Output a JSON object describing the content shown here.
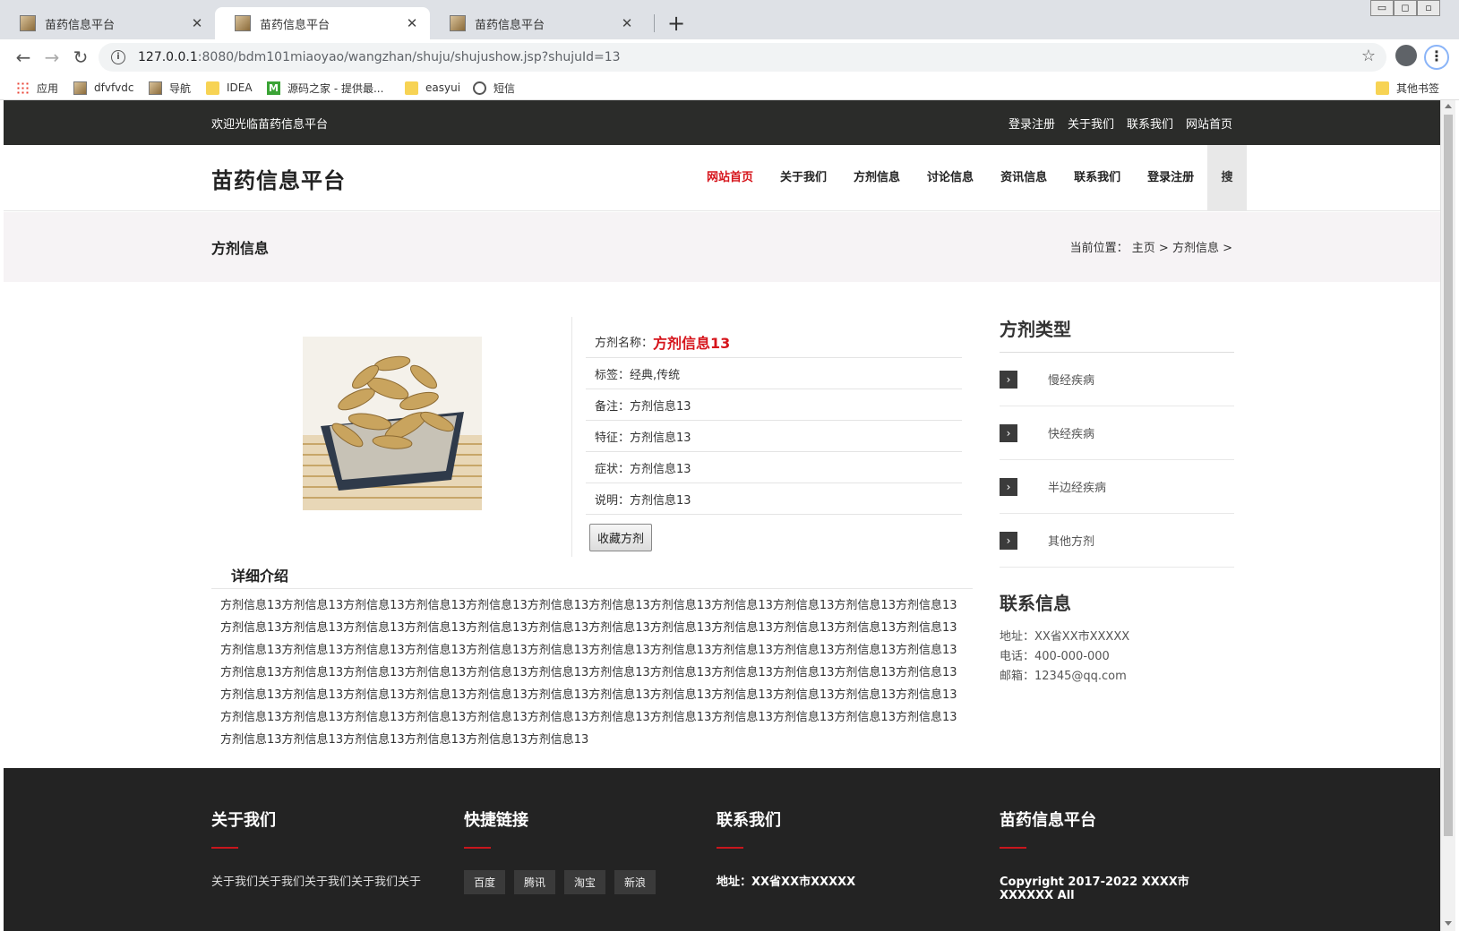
{
  "browser": {
    "tabs": [
      {
        "title": "苗药信息平台",
        "close": "✕"
      },
      {
        "title": "苗药信息平台",
        "close": "✕"
      },
      {
        "title": "苗药信息平台",
        "close": "✕"
      }
    ],
    "new_tab": "+",
    "window_controls": [
      "▭",
      "◻",
      "▫"
    ],
    "url_host": "127.0.0.1",
    "url_path": ":8080/bdm101miaoyao/wangzhan/shuju/shujushow.jsp?shujuId=13",
    "bookmarks": [
      "应用",
      "dfvfvdc",
      "导航",
      "IDEA",
      "源码之家 - 提供最...",
      "easyui",
      "短信"
    ],
    "other_bookmarks": "其他书签"
  },
  "site": {
    "welcome": "欢迎光临苗药信息平台",
    "top_links": [
      "登录注册",
      "关于我们",
      "联系我们",
      "网站首页"
    ],
    "title": "苗药信息平台",
    "nav": [
      "网站首页",
      "关于我们",
      "方剂信息",
      "讨论信息",
      "资讯信息",
      "联系我们",
      "登录注册"
    ],
    "search_label": "搜"
  },
  "banner": {
    "title": "方剂信息",
    "crumb_label": "当前位置：",
    "crumb_home": "主页",
    "crumb_sep": ">",
    "crumb_current": "方剂信息",
    "crumb_tail": ">"
  },
  "product": {
    "name_label": "方剂名称：",
    "name_value": "方剂信息13",
    "rows": [
      {
        "label": "标签：",
        "value": "经典,传统"
      },
      {
        "label": "备注：",
        "value": "方剂信息13"
      },
      {
        "label": "特征：",
        "value": "方剂信息13"
      },
      {
        "label": "症状：",
        "value": "方剂信息13"
      },
      {
        "label": "说明：",
        "value": "方剂信息13"
      }
    ],
    "fav_button": "收藏方剂"
  },
  "detail": {
    "heading": "详细介绍",
    "body": "方剂信息13方剂信息13方剂信息13方剂信息13方剂信息13方剂信息13方剂信息13方剂信息13方剂信息13方剂信息13方剂信息13方剂信息13方剂信息13方剂信息13方剂信息13方剂信息13方剂信息13方剂信息13方剂信息13方剂信息13方剂信息13方剂信息13方剂信息13方剂信息13方剂信息13方剂信息13方剂信息13方剂信息13方剂信息13方剂信息13方剂信息13方剂信息13方剂信息13方剂信息13方剂信息13方剂信息13方剂信息13方剂信息13方剂信息13方剂信息13方剂信息13方剂信息13方剂信息13方剂信息13方剂信息13方剂信息13方剂信息13方剂信息13方剂信息13方剂信息13方剂信息13方剂信息13方剂信息13方剂信息13方剂信息13方剂信息13方剂信息13方剂信息13方剂信息13方剂信息13方剂信息13方剂信息13方剂信息13方剂信息13方剂信息13方剂信息13方剂信息13方剂信息13方剂信息13方剂信息13方剂信息13方剂信息13方剂信息13方剂信息13方剂信息13方剂信息13方剂信息13方剂信息13"
  },
  "sidebar": {
    "types_heading": "方剂类型",
    "types": [
      "慢经疾病",
      "快经疾病",
      "半边经疾病",
      "其他方剂"
    ],
    "arrow": "›",
    "contact_heading": "联系信息",
    "contact": {
      "address": "地址：XX省XX市XXXXX",
      "phone": "电话：400-000-000",
      "email": "邮箱：12345@qq.com"
    }
  },
  "footer": {
    "about_heading": "关于我们",
    "about_text": "关于我们关于我们关于我们关于我们关于",
    "links_heading": "快捷链接",
    "links": [
      "百度",
      "腾讯",
      "淘宝",
      "新浪"
    ],
    "contact_heading": "联系我们",
    "contact_address": "地址：XX省XX市XXXXX",
    "site_heading": "苗药信息平台",
    "copyright": "Copyright 2017-2022 XXXX市XXXXXX All"
  },
  "colors": {
    "accent_red": "#d6141b",
    "topbar": "#2b2c2a",
    "footer": "#232323",
    "banner_bg": "#f6f3f5"
  }
}
